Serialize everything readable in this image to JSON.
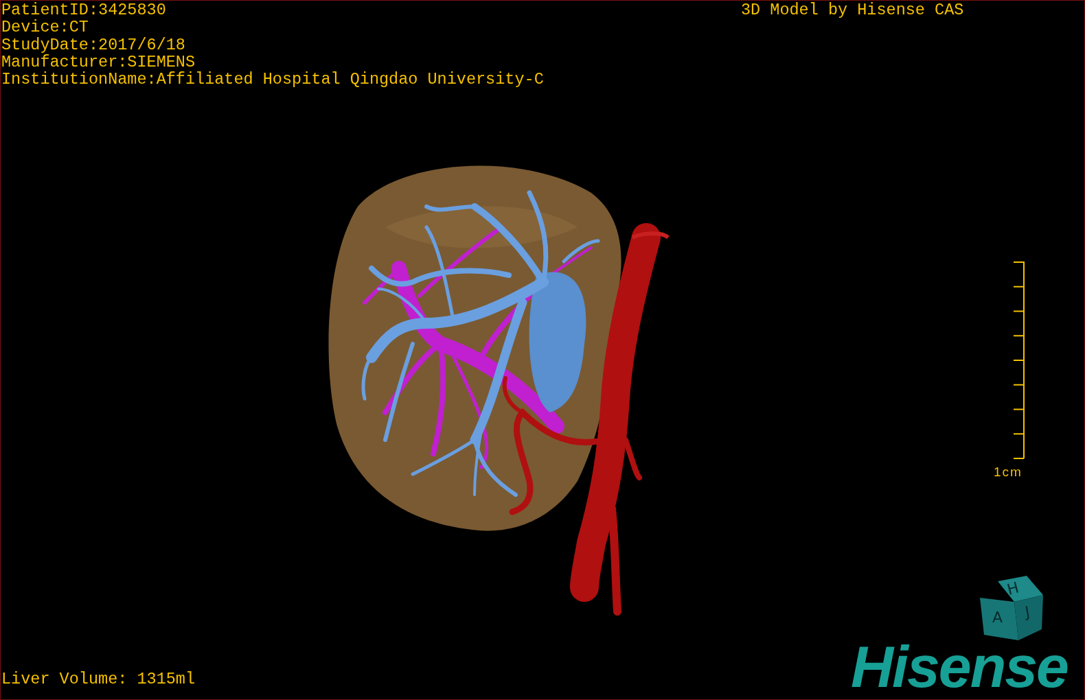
{
  "header_info": [
    "PatientID:3425830",
    "Device:CT",
    "StudyDate:2017/6/18",
    "Manufacturer:SIEMENS",
    "InstitutionName:Affiliated Hospital Qingdao University-C"
  ],
  "credit": "3D Model by Hisense CAS",
  "scale_bar": {
    "label": "1cm"
  },
  "orientation_cube": {
    "labels": [
      "H",
      "A",
      "J"
    ]
  },
  "volume": "Liver Volume: 1315ml",
  "logo": "Hisense"
}
